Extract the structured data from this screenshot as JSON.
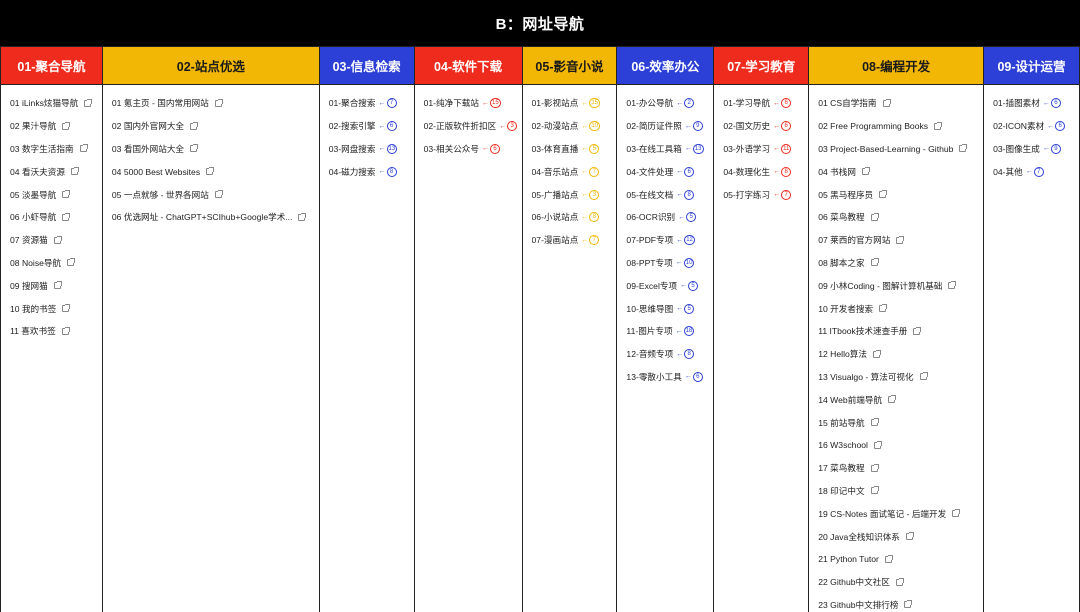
{
  "page": {
    "title": "B：网址导航"
  },
  "colors": {
    "red": "#ef2b1d",
    "yellow": "#f2b705",
    "blue": "#2c3fd6"
  },
  "columns": [
    {
      "header": "01-聚合导航",
      "color": "red",
      "itemsType": "link",
      "items": [
        "01 iLinks炫猫导航",
        "02 果汁导航",
        "03 数字生活指南",
        "04 看沃夫资源",
        "05 淡墨导航",
        "06 小虾导航",
        "07 资源猫",
        "08 Noise导航",
        "09 搜网猫",
        "10 我的书签",
        "11 喜欢书签"
      ]
    },
    {
      "header": "02-站点优选",
      "color": "yellow",
      "itemsType": "link",
      "items": [
        "01 氪主页 - 国内常用网站",
        "02 国内外官网大全",
        "03 看国外网站大全",
        "04 5000 Best Websites",
        "05 一点就够 - 世界各网站",
        "06 优选网址 - ChatGPT+SCIhub+Google学术..."
      ]
    },
    {
      "header": "03-信息检索",
      "color": "blue",
      "itemsType": "badge",
      "items": [
        {
          "label": "01-聚合搜索",
          "count": "7"
        },
        {
          "label": "02-搜索引擎",
          "count": "6"
        },
        {
          "label": "03-网盘搜索",
          "count": "13"
        },
        {
          "label": "04-磁力搜索",
          "count": "8"
        }
      ]
    },
    {
      "header": "04-软件下载",
      "color": "red",
      "itemsType": "badge",
      "items": [
        {
          "label": "01-纯净下载站",
          "count": "15"
        },
        {
          "label": "02-正版软件折扣区",
          "count": "3"
        },
        {
          "label": "03-相关公众号",
          "count": "6"
        }
      ]
    },
    {
      "header": "05-影音小说",
      "color": "yellow",
      "itemsType": "badge",
      "items": [
        {
          "label": "01-影视站点",
          "count": "15"
        },
        {
          "label": "02-动漫站点",
          "count": "10"
        },
        {
          "label": "03-体育直播",
          "count": "5"
        },
        {
          "label": "04-音乐站点",
          "count": "7"
        },
        {
          "label": "05-广播站点",
          "count": "3"
        },
        {
          "label": "06-小说站点",
          "count": "8"
        },
        {
          "label": "07-漫画站点",
          "count": "7"
        }
      ]
    },
    {
      "header": "06-效率办公",
      "color": "blue",
      "itemsType": "badge",
      "items": [
        {
          "label": "01-办公导航",
          "count": "2"
        },
        {
          "label": "02-简历证件照",
          "count": "9"
        },
        {
          "label": "03-在线工具箱",
          "count": "13"
        },
        {
          "label": "04-文件处理",
          "count": "6"
        },
        {
          "label": "05-在线文档",
          "count": "8"
        },
        {
          "label": "06-OCR识别",
          "count": "5"
        },
        {
          "label": "07-PDF专项",
          "count": "12"
        },
        {
          "label": "08-PPT专项",
          "count": "10"
        },
        {
          "label": "09-Excel专项",
          "count": "5"
        },
        {
          "label": "10-思维导图",
          "count": "5"
        },
        {
          "label": "11-图片专项",
          "count": "18"
        },
        {
          "label": "12-音频专项",
          "count": "8"
        },
        {
          "label": "13-零散小工具",
          "count": "6"
        }
      ]
    },
    {
      "header": "07-学习教育",
      "color": "red",
      "itemsType": "badge",
      "items": [
        {
          "label": "01-学习导航",
          "count": "6"
        },
        {
          "label": "02-国文历史",
          "count": "6"
        },
        {
          "label": "03-外语学习",
          "count": "11"
        },
        {
          "label": "04-数理化生",
          "count": "8"
        },
        {
          "label": "05-打字练习",
          "count": "7"
        }
      ]
    },
    {
      "header": "08-编程开发",
      "color": "yellow",
      "itemsType": "link",
      "items": [
        "01 CS自学指南",
        "02 Free Programming Books",
        "03 Project-Based-Learning - Github",
        "04 书栈网",
        "05 黑马程序员",
        "06 菜鸟教程",
        "07 莱西的官方网站",
        "08 脚本之家",
        "09 小林Coding - 图解计算机基础",
        "10 开发者搜索",
        "11 ITbook技术速查手册",
        "12 Hello算法",
        "13 Visualgo - 算法可视化",
        "14 Web前端导航",
        "15 前站导航",
        "16 W3school",
        "17 菜鸟教程",
        "18 印记中文",
        "19 CS-Notes 面试笔记 - 后端开发",
        "20 Java全栈知识体系",
        "21 Python Tutor",
        "22 Github中文社区",
        "23 Github中文排行榜"
      ]
    },
    {
      "header": "09-设计运营",
      "color": "blue",
      "itemsType": "badge",
      "items": [
        {
          "label": "01-插图素材",
          "count": "6"
        },
        {
          "label": "02-ICON素材",
          "count": "6"
        },
        {
          "label": "03-图像生成",
          "count": "9"
        },
        {
          "label": "04-其他",
          "count": "7"
        }
      ]
    }
  ]
}
